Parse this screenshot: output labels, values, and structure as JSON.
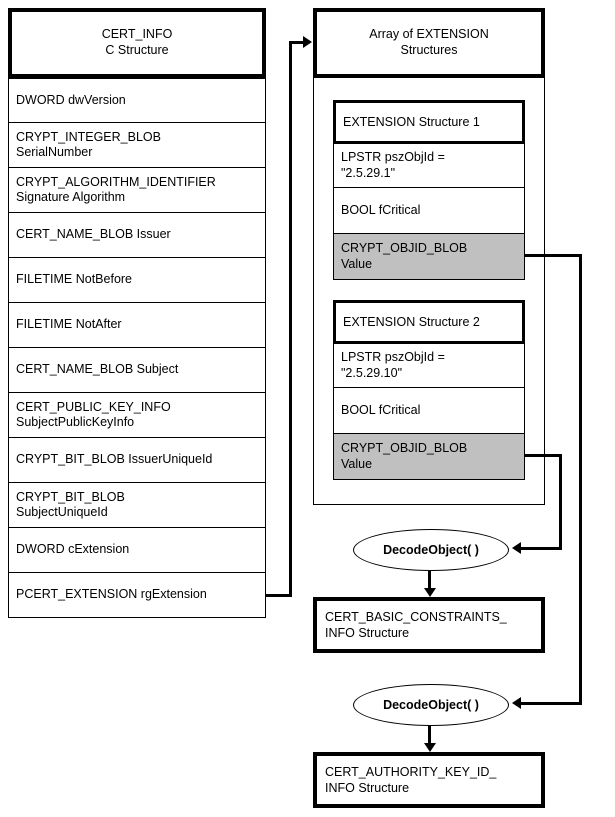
{
  "diagram": {
    "title": "CERT_INFO structure with array of EXTENSION structures decoded by DecodeObject()"
  },
  "cert_info": {
    "header_line1": "CERT_INFO",
    "header_line2": "C Structure",
    "fields": [
      {
        "text": "DWORD dwVersion"
      },
      {
        "text": "CRYPT_INTEGER_BLOB\nSerialNumber"
      },
      {
        "text": "CRYPT_ALGORITHM_IDENTIFIER\nSignature Algorithm"
      },
      {
        "text": "CERT_NAME_BLOB Issuer"
      },
      {
        "text": "FILETIME NotBefore"
      },
      {
        "text": "FILETIME NotAfter"
      },
      {
        "text": "CERT_NAME_BLOB Subject"
      },
      {
        "text": "CERT_PUBLIC_KEY_INFO\nSubjectPublicKeyInfo"
      },
      {
        "text": "CRYPT_BIT_BLOB IssuerUniqueId"
      },
      {
        "text": "CRYPT_BIT_BLOB\nSubjectUniqueId"
      },
      {
        "text": "DWORD cExtension"
      },
      {
        "text": "PCERT_EXTENSION rgExtension"
      }
    ]
  },
  "extension_array": {
    "header_line1": "Array of EXTENSION",
    "header_line2": "Structures",
    "structures": [
      {
        "header": "EXTENSION Structure 1",
        "objid_line1": "LPSTR  pszObjId =",
        "objid_line2": "\"2.5.29.1\"",
        "critical": "BOOL  fCritical",
        "value_line1": "CRYPT_OBJID_BLOB",
        "value_line2": "Value",
        "value_highlight_color": "#c0c0c0"
      },
      {
        "header": "EXTENSION Structure 2",
        "objid_line1": "LPSTR  pszObjId =",
        "objid_line2": "\"2.5.29.10\"",
        "critical": "BOOL  fCritical",
        "value_line1": "CRYPT_OBJID_BLOB",
        "value_line2": "Value",
        "value_highlight_color": "#c0c0c0"
      }
    ]
  },
  "decode_nodes": [
    {
      "label": "DecodeObject( )"
    },
    {
      "label": "DecodeObject( )"
    }
  ],
  "result_structures": [
    {
      "line1": "CERT_BASIC_CONSTRAINTS_",
      "line2": "INFO Structure"
    },
    {
      "line1": "CERT_AUTHORITY_KEY_ID_",
      "line2": "INFO Structure"
    }
  ]
}
